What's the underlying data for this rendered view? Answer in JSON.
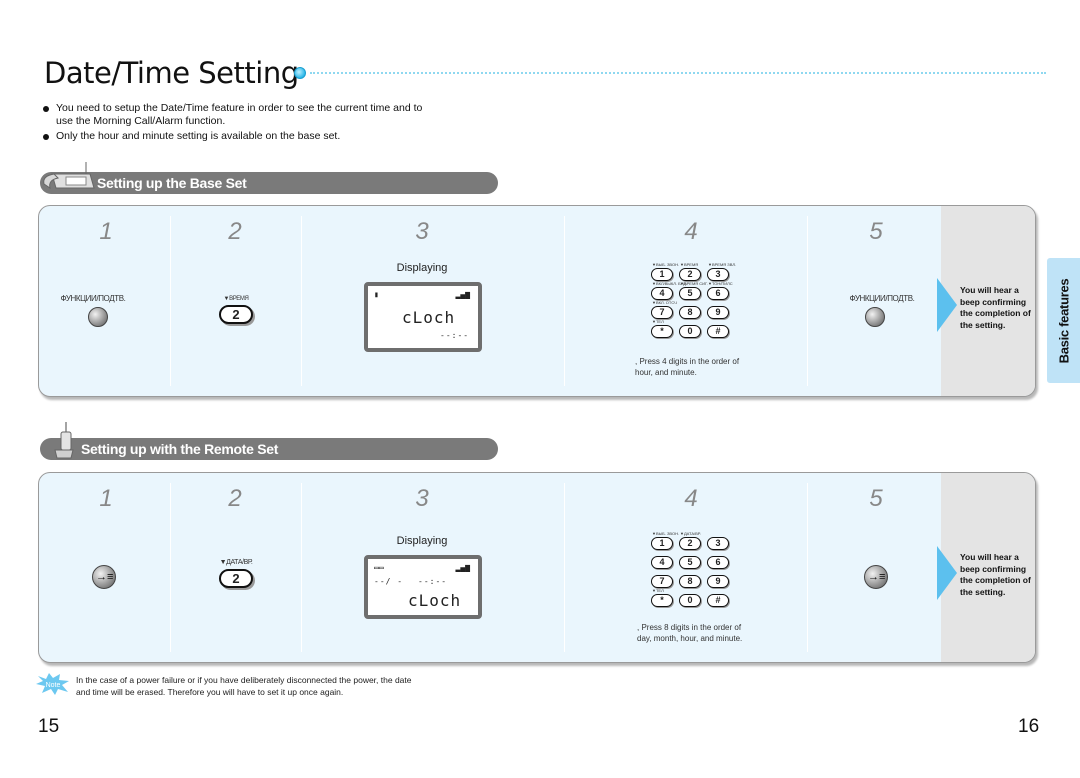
{
  "page": {
    "title": "Date/Time Setting",
    "bullets": [
      "You need to setup the Date/Time feature in order to see the current time and to use the Morning Call/Alarm function.",
      "Only the hour and minute setting is available on the base set."
    ],
    "side_tab": "Basic features",
    "page_numbers": {
      "left": "15",
      "right": "16"
    }
  },
  "base_set": {
    "section_title": "Setting up the Base Set",
    "icon": "base-phone-icon",
    "steps": [
      {
        "num": "1",
        "button_label": "ФУНКЦИИ/ПОДТВ.",
        "button": "function-button"
      },
      {
        "num": "2",
        "button_label": "▼ВРЕМЯ",
        "key": "2"
      },
      {
        "num": "3",
        "displaying_label": "Displaying",
        "lcd_word": "cLoch",
        "lcd_time": "--:--"
      },
      {
        "num": "4",
        "keys": [
          "1",
          "2",
          "3",
          "4",
          "5",
          "6",
          "7",
          "8",
          "9",
          "*",
          "0",
          "#"
        ],
        "key_labels": [
          "▼ВЫБ. ЗВОН.",
          "▼ВРЕМЯ",
          "▼ВРЕМЯ ЗВЛ.",
          "▼ВКЛ/ВЫКЛ. БУД.",
          "▼ВРЕМЯ СИГ.",
          "▼ТОН/ПИЛС",
          "▼ВКЛ. ОТСЧ",
          "",
          "",
          "▼ТЕЛ",
          "",
          ""
        ],
        "note": "Press 4 digits in the order of hour, and minute."
      },
      {
        "num": "5",
        "button_label": "ФУНКЦИИ/ПОДТВ.",
        "button": "function-button"
      }
    ],
    "result": "You will hear a beep confirming the completion of the setting."
  },
  "remote_set": {
    "section_title": "Setting up with the Remote Set",
    "icon": "handset-icon",
    "steps": [
      {
        "num": "1",
        "button": "menu-button"
      },
      {
        "num": "2",
        "button_label": "▼ДАТА/ВР.",
        "key": "2"
      },
      {
        "num": "3",
        "displaying_label": "Displaying",
        "lcd_date": "--/ -",
        "lcd_time": "--:--",
        "lcd_word": "cLoch"
      },
      {
        "num": "4",
        "keys": [
          "1",
          "2",
          "3",
          "4",
          "5",
          "6",
          "7",
          "8",
          "9",
          "*",
          "0",
          "#"
        ],
        "key_labels": [
          "▼ВЫБ. ЗВОН.",
          "▼ДАТА/ВР.",
          "",
          "",
          "",
          "",
          "",
          "",
          "",
          "▼ТЕЛ",
          "",
          ""
        ],
        "note": "Press 8 digits in the order of day, month, hour, and minute."
      },
      {
        "num": "5",
        "button": "menu-button"
      }
    ],
    "result": "You will hear a beep confirming the completion of the setting."
  },
  "note": {
    "badge": "Note",
    "text": "In the case of a power failure or if you have deliberately disconnected the power, the date and time will be erased.  Therefore you will have to set it up once again."
  },
  "colors": {
    "accent": "#5cc0ee",
    "panel": "#eaf6fd",
    "section_bar": "#7a7a7a",
    "side_tab": "#bfe3f7"
  }
}
